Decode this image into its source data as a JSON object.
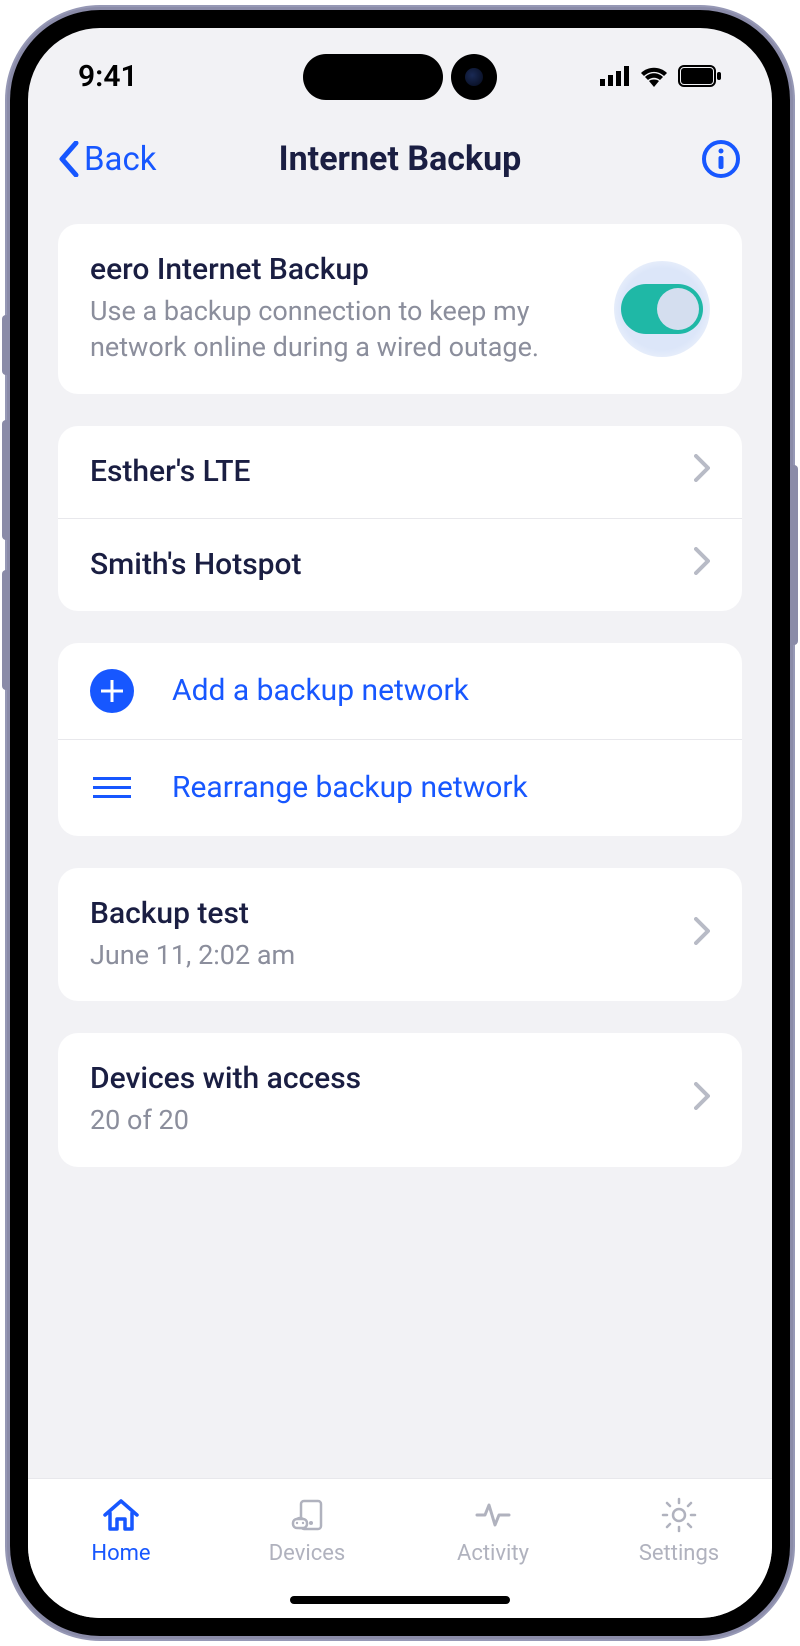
{
  "status": {
    "time": "9:41"
  },
  "nav": {
    "back": "Back",
    "title": "Internet Backup"
  },
  "feature": {
    "title": "eero Internet Backup",
    "subtitle": "Use a backup connection to keep my network online during a wired outage.",
    "enabled": true
  },
  "networks": [
    {
      "name": "Esther's LTE"
    },
    {
      "name": "Smith's Hotspot"
    }
  ],
  "actions": {
    "add": "Add a backup network",
    "rearrange": "Rearrange backup network"
  },
  "backup_test": {
    "title": "Backup test",
    "timestamp": "June 11, 2:02 am"
  },
  "devices": {
    "title": "Devices with access",
    "count": "20 of 20"
  },
  "tabs": [
    {
      "id": "home",
      "label": "Home",
      "active": true
    },
    {
      "id": "devices",
      "label": "Devices",
      "active": false
    },
    {
      "id": "activity",
      "label": "Activity",
      "active": false
    },
    {
      "id": "settings",
      "label": "Settings",
      "active": false
    }
  ]
}
